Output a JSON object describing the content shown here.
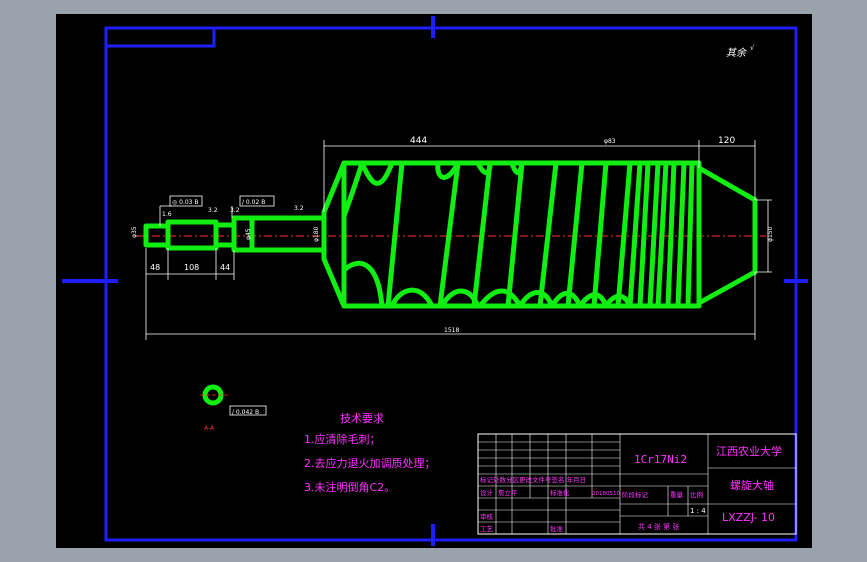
{
  "drawing": {
    "roughness": "其余",
    "dims": {
      "top_len": "444",
      "pitch": "φ83",
      "right_len": "120",
      "total": "1518",
      "d48": "48",
      "d108": "108",
      "d44": "44",
      "dia_left": "φ35",
      "dia_mid": "φ45",
      "dia_shaft": "φ80",
      "dia_body": "φ180",
      "dia_right": "φ150",
      "r1": "1.6",
      "r2": "3.2",
      "r3": "3.2",
      "r4": "3.2",
      "tol1": "◎ 0.03 B",
      "tol2": "/ 0.02 B",
      "tol3": "/ 0.042 B",
      "section": "A-A"
    }
  },
  "tech": {
    "title": "技术要求",
    "items": [
      "1.应清除毛刺；",
      "2.去应力退火加调质处理；",
      "3.未注明倒角C2。"
    ]
  },
  "titleblock": {
    "material": "1Cr17Ni2",
    "school": "江西农业大学",
    "part": "螺旋大轴",
    "code": "LXZZJ- 10",
    "rev_header": "标记处数分区更改文件号签名 年月日",
    "design": "设计",
    "designer": "詹立平",
    "std": "标准化",
    "date": "20180510",
    "stage": "阶段标记",
    "weight": "重量",
    "scale": "比例",
    "scale_val": "1 : 4",
    "review": "审核",
    "craft": "工艺",
    "approve": "批准",
    "sheets": "共 4 张  第 张"
  }
}
